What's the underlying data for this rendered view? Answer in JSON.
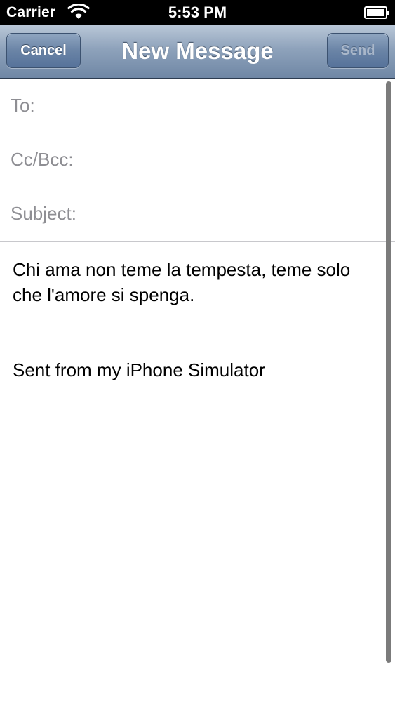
{
  "status_bar": {
    "carrier": "Carrier",
    "time": "5:53 PM",
    "wifi_icon": "wifi-icon",
    "battery_icon": "battery-icon"
  },
  "nav": {
    "title": "New Message",
    "cancel_label": "Cancel",
    "send_label": "Send"
  },
  "fields": {
    "to_label": "To:",
    "cc_label": "Cc/Bcc:",
    "subject_label": "Subject:"
  },
  "message": {
    "body": "Chi ama non teme la tempesta, teme solo che l'amore si spenga.",
    "signature": "Sent from my iPhone Simulator"
  },
  "colors": {
    "nav_top": "#b9c7d7",
    "nav_bottom": "#6f87a5",
    "label_gray": "#8e8e93",
    "separator": "#c8c8cc"
  }
}
